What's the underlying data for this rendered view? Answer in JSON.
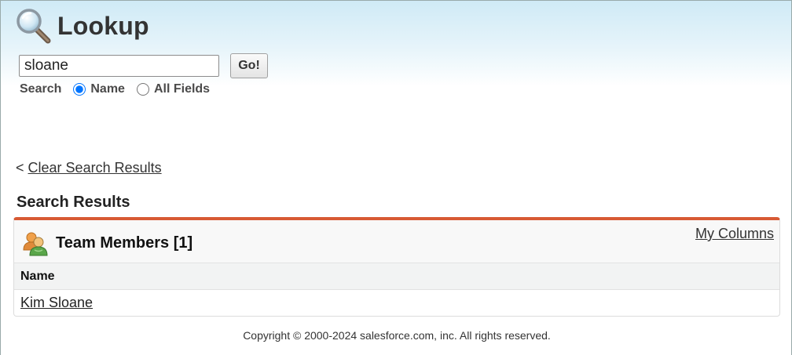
{
  "header": {
    "title": "Lookup",
    "icon": "magnifier-icon"
  },
  "search": {
    "value": "sloane",
    "go_label": "Go!"
  },
  "scope": {
    "label": "Search",
    "options": [
      {
        "label": "Name",
        "selected": true
      },
      {
        "label": "All Fields",
        "selected": false
      }
    ]
  },
  "clear": {
    "prefix": "<",
    "link": "Clear Search Results"
  },
  "results": {
    "heading": "Search Results",
    "panel_title": "Team Members [1]",
    "my_columns": "My Columns",
    "columns": [
      "Name"
    ],
    "rows": [
      [
        "Kim Sloane"
      ]
    ]
  },
  "footer": {
    "copyright": "Copyright © 2000-2024 salesforce.com, inc. All rights reserved."
  },
  "colors": {
    "accent": "#d75a34",
    "header_bg": "#cfeaf6"
  }
}
